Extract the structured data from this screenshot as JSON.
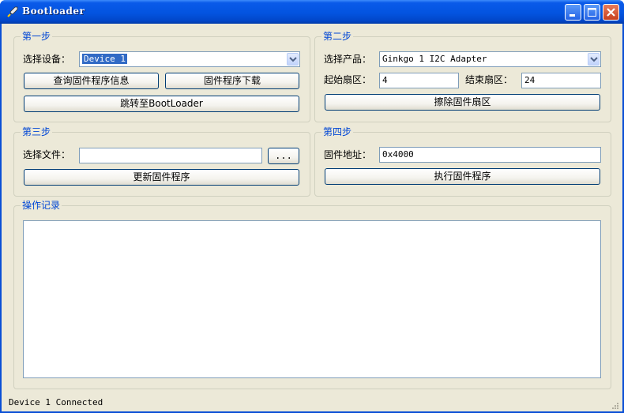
{
  "window": {
    "title": "Bootloader"
  },
  "step1": {
    "title": "第一步",
    "device_label": "选择设备：",
    "device_value": "Device 1",
    "query_button": "查询固件程序信息",
    "download_button": "固件程序下载",
    "jump_button": "跳转至BootLoader"
  },
  "step2": {
    "title": "第二步",
    "product_label": "选择产品：",
    "product_value": "Ginkgo 1 I2C Adapter",
    "start_sector_label": "起始扇区：",
    "start_sector_value": "4",
    "end_sector_label": "结束扇区：",
    "end_sector_value": "24",
    "erase_button": "擦除固件扇区"
  },
  "step3": {
    "title": "第三步",
    "file_label": "选择文件：",
    "file_value": "",
    "browse_button": "...",
    "update_button": "更新固件程序"
  },
  "step4": {
    "title": "第四步",
    "address_label": "固件地址：",
    "address_value": "0x4000",
    "execute_button": "执行固件程序"
  },
  "log": {
    "title": "操作记录",
    "content": ""
  },
  "status": {
    "text": "Device 1 Connected"
  },
  "colors": {
    "titlebar": "#0354e0",
    "group_title": "#0046d5",
    "selection": "#316ac5",
    "face": "#ece9d8"
  }
}
